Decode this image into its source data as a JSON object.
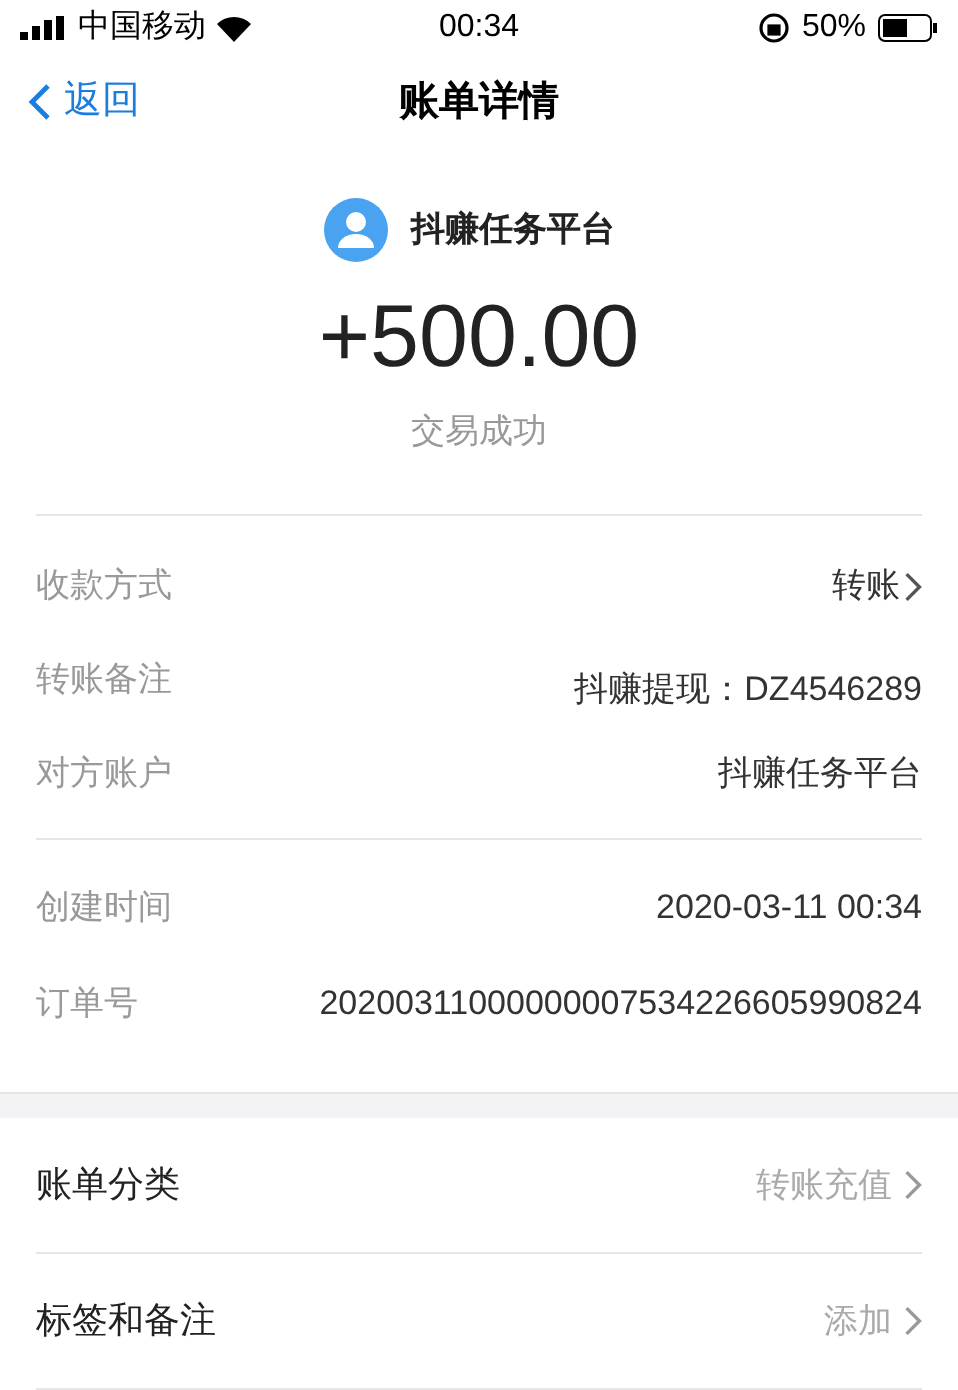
{
  "status_bar": {
    "carrier": "中国移动",
    "time": "00:34",
    "battery": "50%"
  },
  "nav": {
    "back": "返回",
    "title": "账单详情"
  },
  "header": {
    "name": "抖赚任务平台",
    "amount": "+500.00",
    "status": "交易成功"
  },
  "details": [
    {
      "label": "收款方式",
      "value": "转账",
      "link": true
    },
    {
      "label": "转账备注",
      "value": "抖赚提现：DZ4546289",
      "link": false
    },
    {
      "label": "对方账户",
      "value": "抖赚任务平台",
      "link": false
    }
  ],
  "details2": [
    {
      "label": "创建时间",
      "value": "2020-03-11 00:34"
    },
    {
      "label": "订单号",
      "value": "20200311000000007534226605990824"
    }
  ],
  "actions": [
    {
      "label": "账单分类",
      "value": "转账充值"
    },
    {
      "label": "标签和备注",
      "value": "添加"
    }
  ]
}
